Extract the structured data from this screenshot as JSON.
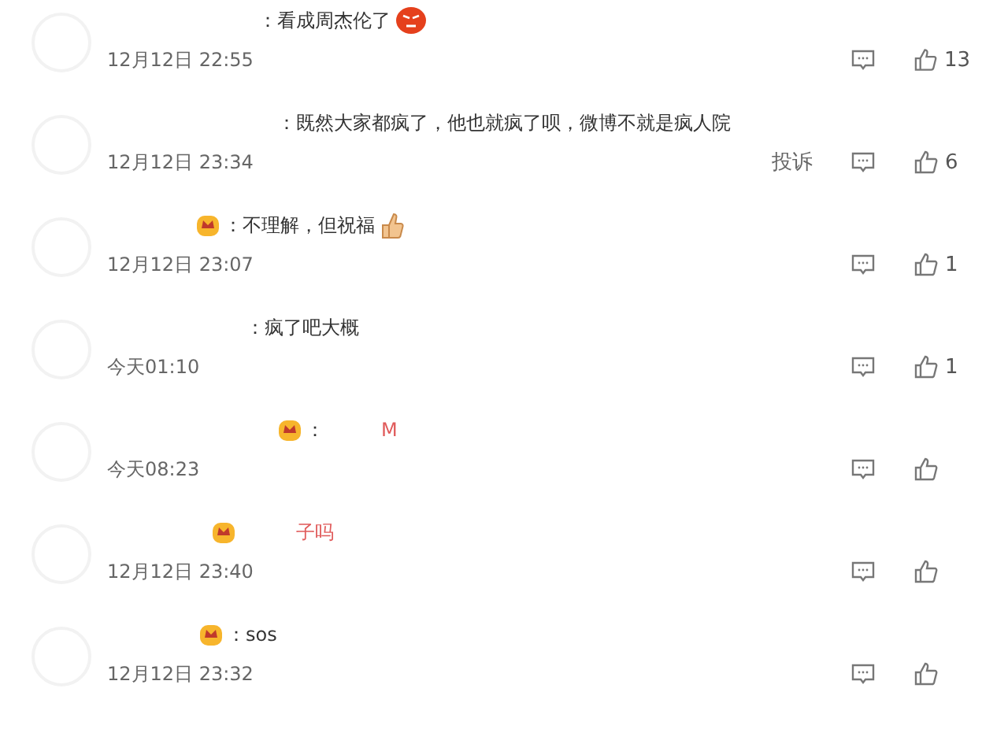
{
  "comments": [
    {
      "badge": false,
      "text": "：看成周杰伦了",
      "emoji": {
        "kind": "angry"
      },
      "time": "12月12日 22:55",
      "likes": "13"
    },
    {
      "badge": false,
      "text": "：既然大家都疯了，他也就疯了呗，微博不就是疯人院",
      "time": "12月12日 23:34",
      "report": "投诉",
      "likes": "6"
    },
    {
      "badge": true,
      "text": "：不理解，但祝福",
      "emoji": {
        "kind": "thumb"
      },
      "time": "12月12日 23:07",
      "likes": "1"
    },
    {
      "badge": false,
      "text": "：疯了吧大概",
      "time": "今天01:10",
      "likes": "1"
    },
    {
      "badge": true,
      "text": "：",
      "tail": "M",
      "time": "今天08:23"
    },
    {
      "badge": true,
      "tail": "子吗",
      "time": "12月12日 23:40"
    },
    {
      "badge": true,
      "text": "：sos",
      "time": "12月12日 23:32"
    }
  ]
}
